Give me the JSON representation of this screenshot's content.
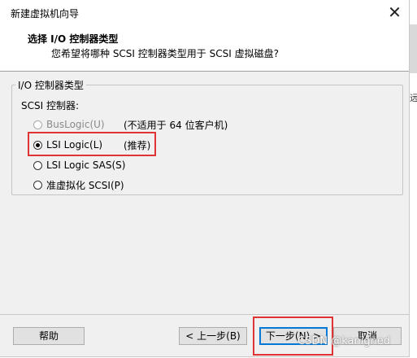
{
  "window": {
    "title": "新建虚拟机向导",
    "close_glyph": "✕"
  },
  "header": {
    "title": "选择 I/O 控制器类型",
    "subtitle": "您希望将哪种 SCSI 控制器类型用于 SCSI 虚拟磁盘?"
  },
  "group": {
    "legend": "I/O 控制器类型",
    "scsi_label": "SCSI 控制器:",
    "options": [
      {
        "label": "BusLogic(U)",
        "note": "(不适用于 64 位客户机)",
        "checked": false,
        "disabled": true
      },
      {
        "label": "LSI Logic(L)",
        "note": "(推荐)",
        "checked": true,
        "disabled": false
      },
      {
        "label": "LSI Logic SAS(S)",
        "note": "",
        "checked": false,
        "disabled": false
      },
      {
        "label": "准虚拟化 SCSI(P)",
        "note": "",
        "checked": false,
        "disabled": false
      }
    ]
  },
  "buttons": {
    "help": "帮助",
    "back": "< 上一步(B)",
    "next": "下一步(N) >",
    "cancel": "取消"
  },
  "watermark": "CSDN @kanigned",
  "right_strip_char": "远",
  "colors": {
    "highlight": "#e03434",
    "dialog_bg": "#f0f0f0",
    "default_button_border": "#0078d7"
  }
}
